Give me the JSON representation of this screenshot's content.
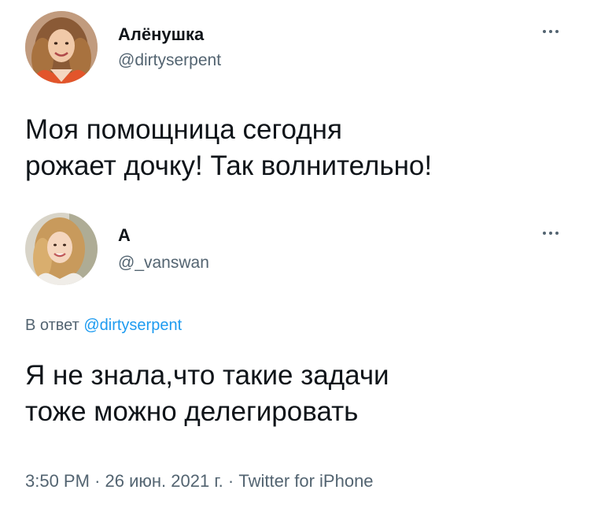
{
  "original_tweet": {
    "display_name": "Алёнушка",
    "handle": "@dirtyserpent",
    "text": "Моя помощница сегодня\nрожает дочку! Так волнительно!",
    "avatar_icon": "user-avatar-photo"
  },
  "reply_tweet": {
    "display_name": "А",
    "handle": "@_vanswan",
    "reply_prefix": "В ответ",
    "reply_mention": "@dirtyserpent",
    "text": "Я не знала,что такие задачи\nтоже можно делегировать",
    "avatar_icon": "user-avatar-photo"
  },
  "meta": {
    "time": "3:50 PM",
    "separator": "·",
    "date": "26 июн. 2021 г.",
    "source": "Twitter for iPhone"
  },
  "colors": {
    "text_primary": "#0f1419",
    "text_secondary": "#536471",
    "link_blue": "#1d9bf0"
  }
}
